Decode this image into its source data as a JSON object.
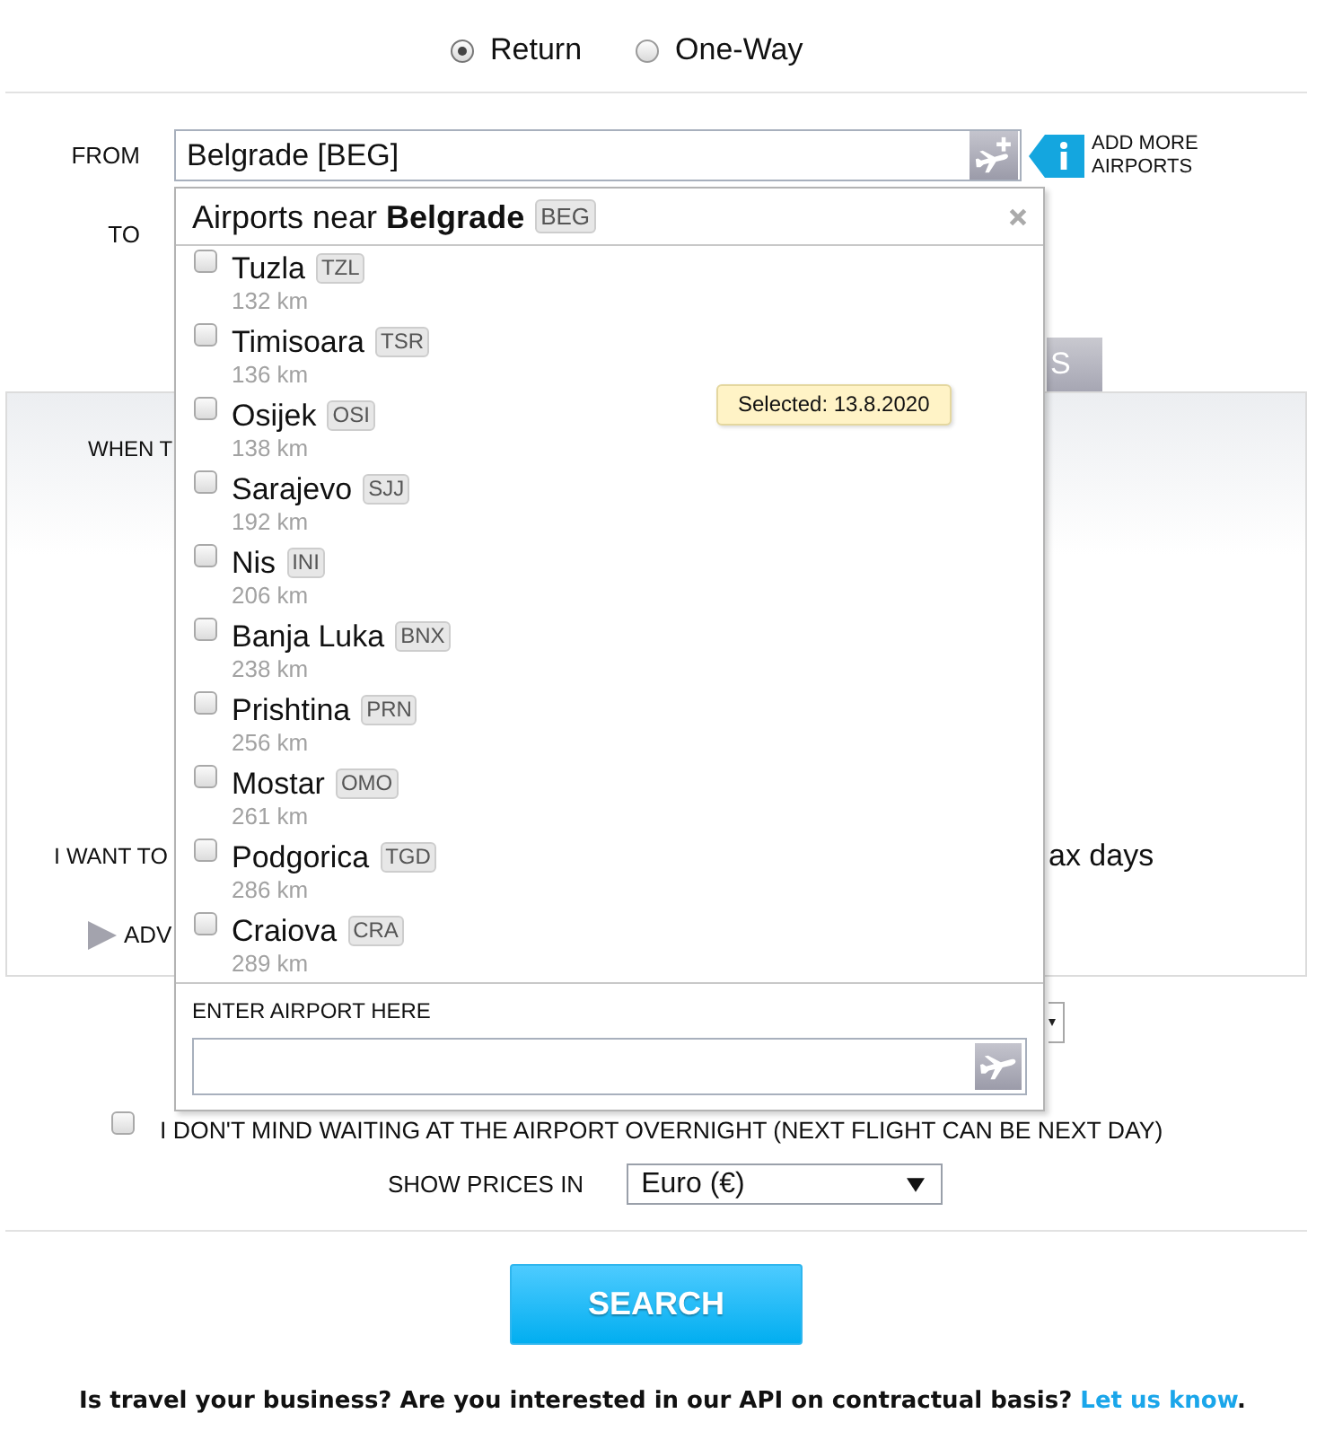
{
  "trip_type": [
    {
      "label": "Return",
      "selected": true
    },
    {
      "label": "One-Way",
      "selected": false
    }
  ],
  "from": {
    "label": "FROM",
    "value": "Belgrade [BEG]",
    "add_more": "ADD MORE AIRPORTS"
  },
  "to": {
    "label": "TO"
  },
  "tab": {
    "label": "S"
  },
  "dates_panel": {
    "when_label": "WHEN T",
    "stay_label": "I WANT TO",
    "stay_suffix": "ax days",
    "advanced": "ADV"
  },
  "overnight": {
    "label": "I DON'T MIND WAITING AT THE AIRPORT OVERNIGHT (NEXT FLIGHT CAN BE NEXT DAY)",
    "checked": false
  },
  "currency": {
    "label": "SHOW PRICES IN",
    "value": "Euro (€)"
  },
  "search_button": {
    "label": "SEARCH"
  },
  "footer": {
    "text": "Is travel your business? Are you interested in our API on contractual basis?",
    "link": "Let us know",
    "end": "."
  },
  "airport_popup": {
    "title": "Airports near **Belgrade**",
    "code": "BEG",
    "airports": [
      {
        "name": "Tuzla",
        "code": "TZL",
        "distance": "132 km",
        "checked": false
      },
      {
        "name": "Timisoara",
        "code": "TSR",
        "distance": "136 km",
        "checked": false
      },
      {
        "name": "Osijek",
        "code": "OSI",
        "distance": "138 km",
        "checked": false
      },
      {
        "name": "Sarajevo",
        "code": "SJJ",
        "distance": "192 km",
        "checked": false
      },
      {
        "name": "Nis",
        "code": "INI",
        "distance": "206 km",
        "checked": false
      },
      {
        "name": "Banja Luka",
        "code": "BNX",
        "distance": "238 km",
        "checked": false
      },
      {
        "name": "Prishtina",
        "code": "PRN",
        "distance": "256 km",
        "checked": false
      },
      {
        "name": "Mostar",
        "code": "OMO",
        "distance": "261 km",
        "checked": false
      },
      {
        "name": "Podgorica",
        "code": "TGD",
        "distance": "286 km",
        "checked": false
      },
      {
        "name": "Craiova",
        "code": "CRA",
        "distance": "289 km",
        "checked": false
      }
    ],
    "enter_label": "ENTER AIRPORT HERE"
  },
  "tooltip": {
    "text": "Selected: 13.8.2020"
  }
}
